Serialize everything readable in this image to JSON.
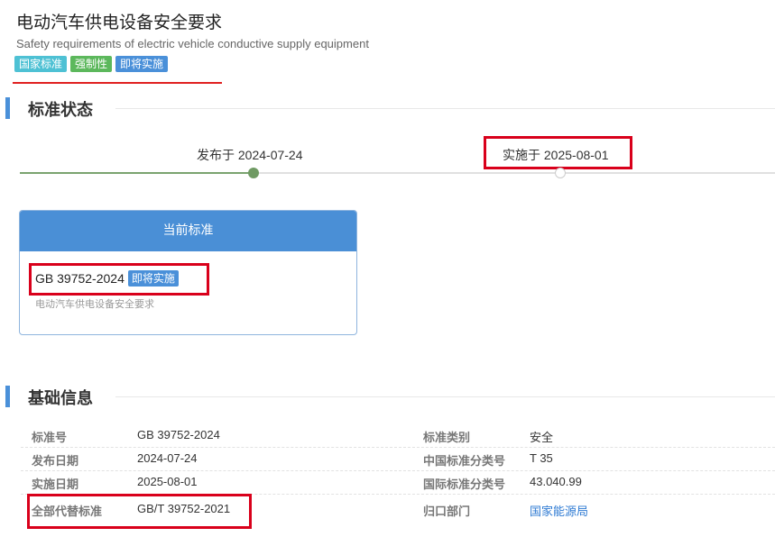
{
  "header": {
    "title_cn": "电动汽车供电设备安全要求",
    "title_en": "Safety requirements of electric vehicle conductive supply equipment",
    "tags": [
      "国家标准",
      "强制性",
      "即将实施"
    ]
  },
  "status_section": {
    "title": "标准状态",
    "timeline": {
      "published_label": "发布于 2024-07-24",
      "implemented_label": "实施于 2025-08-01"
    },
    "card": {
      "header": "当前标准",
      "standard_no": "GB 39752-2024",
      "badge": "即将实施",
      "subtitle": "电动汽车供电设备安全要求"
    }
  },
  "info_section": {
    "title": "基础信息",
    "rows": [
      {
        "label1": "标准号",
        "value1": "GB 39752-2024",
        "label2": "标准类别",
        "value2": "安全"
      },
      {
        "label1": "发布日期",
        "value1": "2024-07-24",
        "label2": "中国标准分类号",
        "value2": "T 35"
      },
      {
        "label1": "实施日期",
        "value1": "2025-08-01",
        "label2": "国际标准分类号",
        "value2": "43.040.99"
      },
      {
        "label1": "全部代替标准",
        "value1": "GB/T 39752-2021",
        "label2": "归口部门",
        "value2": "国家能源局"
      }
    ]
  },
  "colors": {
    "accent_blue": "#4a90d9",
    "highlight_red": "#d9001b",
    "timeline_green": "#6f9a63",
    "link_blue": "#2f7bd3"
  }
}
